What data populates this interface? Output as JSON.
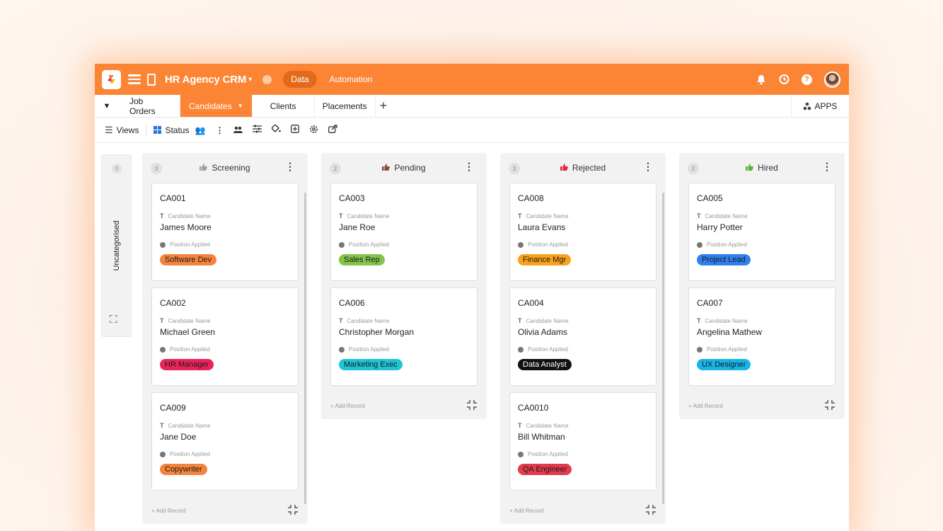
{
  "header": {
    "app_title": "HR Agency CRM",
    "data_tab": "Data",
    "automation_tab": "Automation"
  },
  "tabs": {
    "job_orders": "Job Orders",
    "candidates": "Candidates",
    "clients": "Clients",
    "placements": "Placements",
    "apps": "APPS"
  },
  "toolbar": {
    "views": "Views",
    "status": "Status"
  },
  "uncategorised": {
    "label": "Uncategorised",
    "count": "0"
  },
  "labels": {
    "candidate_name": "Candidate Name",
    "position_applied": "Position Applied",
    "add_record": "+ Add Record"
  },
  "columns": [
    {
      "title": "Screening",
      "count": "3",
      "icon_color": "#9e9e9e",
      "cards": [
        {
          "id": "CA001",
          "name": "James Moore",
          "position": "Software Dev",
          "color": "#f4843d"
        },
        {
          "id": "CA002",
          "name": "Michael Green",
          "position": "HR Manager",
          "color": "#e8245a"
        },
        {
          "id": "CA009",
          "name": "Jane Doe",
          "position": "Copywriter",
          "color": "#f4843d"
        }
      ]
    },
    {
      "title": "Pending",
      "count": "2",
      "icon_color": "#8a4b3a",
      "cards": [
        {
          "id": "CA003",
          "name": "Jane Roe",
          "position": "Sales Rep",
          "color": "#84c34a"
        },
        {
          "id": "CA006",
          "name": "Christopher Morgan",
          "position": "Marketing Exec",
          "color": "#1fc4d4"
        }
      ]
    },
    {
      "title": "Rejected",
      "count": "3",
      "icon_color": "#e2263a",
      "cards": [
        {
          "id": "CA008",
          "name": "Laura Evans",
          "position": "Finance Mgr",
          "color": "#f9a11b"
        },
        {
          "id": "CA004",
          "name": "Olivia Adams",
          "position": "Data Analyst",
          "color": "#111111"
        },
        {
          "id": "CA0010",
          "name": "Bill Whitman",
          "position": "QA Engineer",
          "color": "#e33a4c"
        }
      ]
    },
    {
      "title": "Hired",
      "count": "2",
      "icon_color": "#5cb232",
      "cards": [
        {
          "id": "CA005",
          "name": "Harry Potter",
          "position": "Project Lead",
          "color": "#2f80ed"
        },
        {
          "id": "CA007",
          "name": "Angelina Mathew",
          "position": "UX Designer",
          "color": "#17b5e6"
        }
      ]
    }
  ]
}
